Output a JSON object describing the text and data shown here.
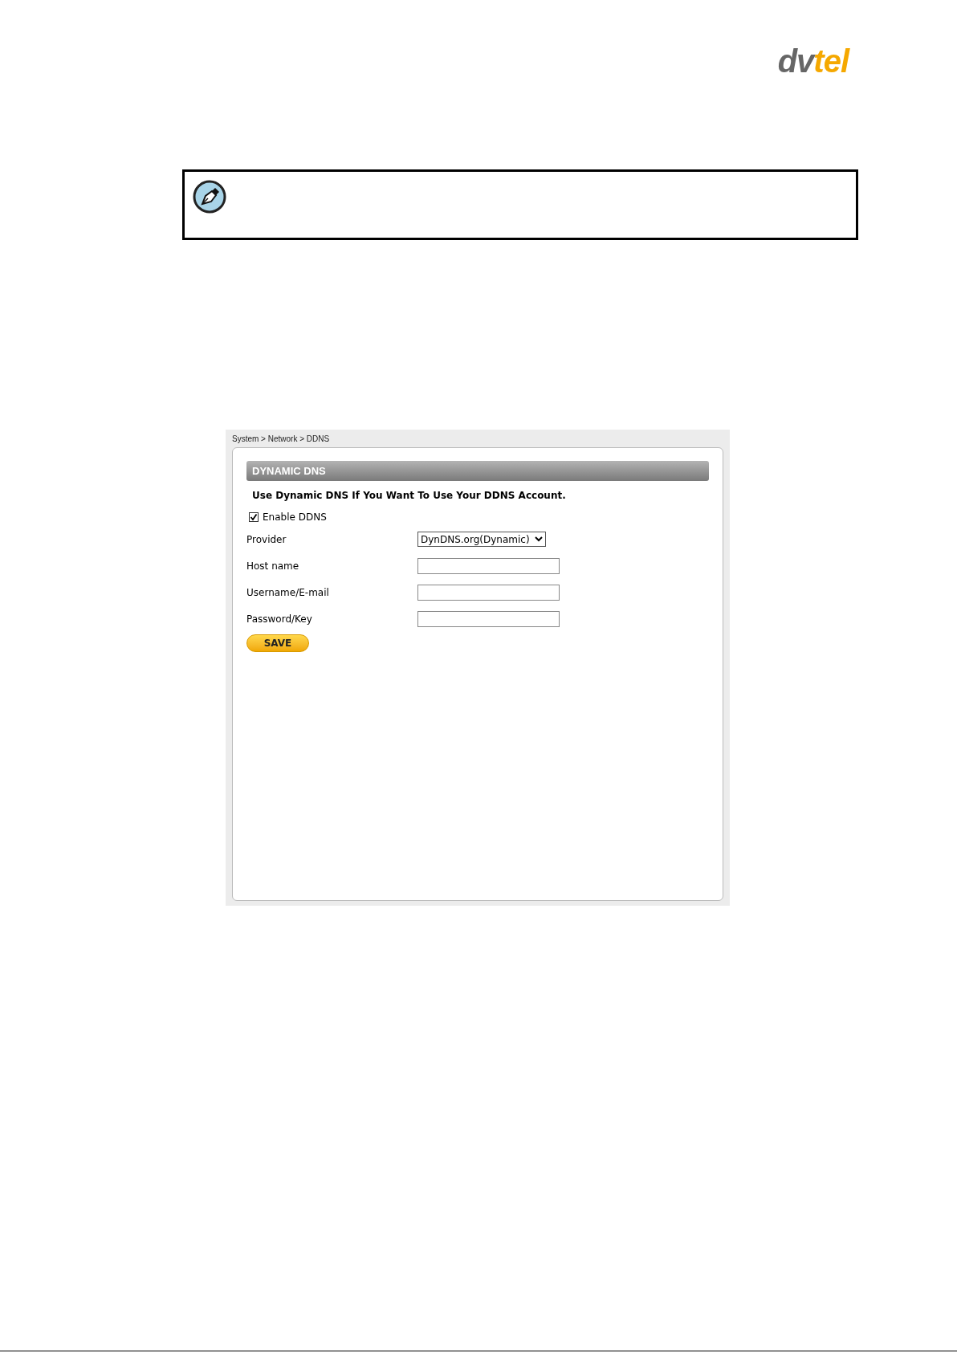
{
  "logo": {
    "parts": [
      {
        "text": "dv",
        "color": "#666666"
      },
      {
        "text": "tel",
        "color": "#f5a800"
      }
    ]
  },
  "note": {
    "kind": "note"
  },
  "screenshot": {
    "breadcrumb": "System > Network > DDNS",
    "section_title": "DYNAMIC DNS",
    "intro": "Use Dynamic DNS If You Want To Use Your DDNS Account.",
    "enable": {
      "label": "Enable DDNS",
      "checked": true
    },
    "fields": [
      {
        "label": "Provider",
        "kind": "select",
        "value": "DynDNS.org(Dynamic)"
      },
      {
        "label": "Host name",
        "kind": "text"
      },
      {
        "label": "Username/E-mail",
        "kind": "text"
      },
      {
        "label": "Password/Key",
        "kind": "text"
      }
    ],
    "save_button": "SAVE"
  }
}
